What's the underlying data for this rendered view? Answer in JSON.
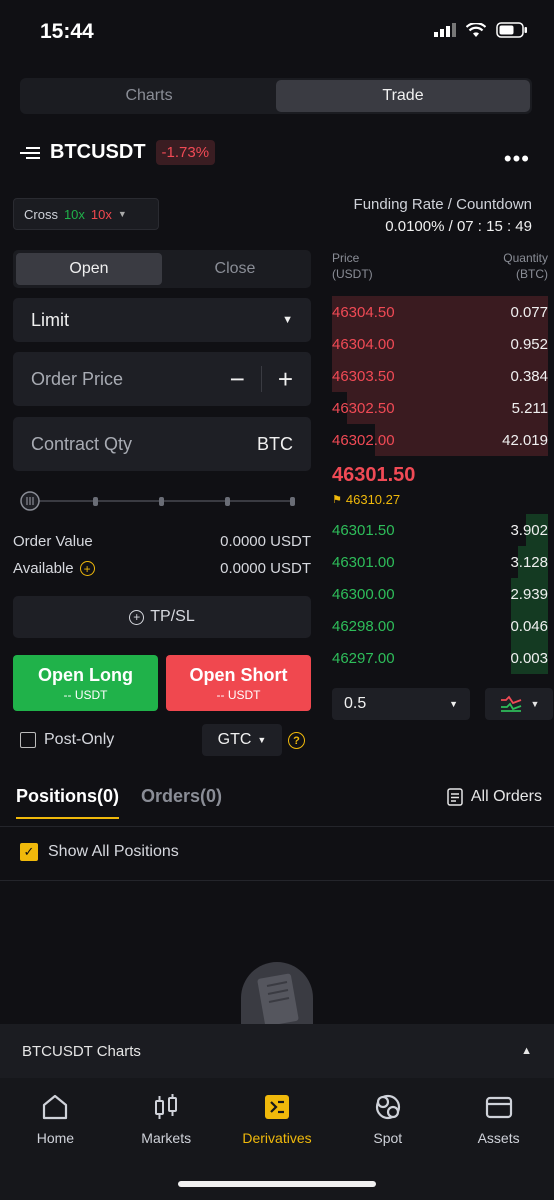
{
  "status": {
    "time": "15:44"
  },
  "view_tabs": [
    {
      "label": "Charts"
    },
    {
      "label": "Trade"
    }
  ],
  "symbol": {
    "name": "BTCUSDT",
    "change": "-1.73%"
  },
  "leverage": {
    "mode": "Cross",
    "long": "10x",
    "short": "10x"
  },
  "funding": {
    "label": "Funding Rate / Countdown",
    "value": "0.0100% / 07 : 15 : 49"
  },
  "order_tabs": [
    {
      "label": "Open"
    },
    {
      "label": "Close"
    }
  ],
  "order_type": "Limit",
  "order_price": {
    "placeholder": "Order Price"
  },
  "contract_qty": {
    "placeholder": "Contract Qty",
    "unit": "BTC"
  },
  "summary": {
    "order_value_label": "Order Value",
    "order_value": "0.0000 USDT",
    "available_label": "Available",
    "available": "0.0000 USDT"
  },
  "tpsl": "TP/SL",
  "open_long": {
    "label": "Open Long",
    "sub": "-- USDT"
  },
  "open_short": {
    "label": "Open Short",
    "sub": "-- USDT"
  },
  "post_only": "Post-Only",
  "time_in_force": "GTC",
  "orderbook": {
    "price_header": "Price",
    "price_unit": "(USDT)",
    "qty_header": "Quantity",
    "qty_unit": "(BTC)",
    "asks": [
      {
        "price": "46304.50",
        "qty": "0.077"
      },
      {
        "price": "46304.00",
        "qty": "0.952"
      },
      {
        "price": "46303.50",
        "qty": "0.384"
      },
      {
        "price": "46302.50",
        "qty": "5.211"
      },
      {
        "price": "46302.00",
        "qty": "42.019"
      }
    ],
    "last_price": "46301.50",
    "mark_price": "46310.27",
    "bids": [
      {
        "price": "46301.50",
        "qty": "3.902"
      },
      {
        "price": "46301.00",
        "qty": "3.128"
      },
      {
        "price": "46300.00",
        "qty": "2.939"
      },
      {
        "price": "46298.00",
        "qty": "0.046"
      },
      {
        "price": "46297.00",
        "qty": "0.003"
      }
    ],
    "depth": "0.5"
  },
  "positions_tabs": [
    {
      "label": "Positions(0)"
    },
    {
      "label": "Orders(0)"
    }
  ],
  "all_orders": "All Orders",
  "show_all_positions": "Show All Positions",
  "charts_bar": "BTCUSDT Charts",
  "nav": [
    {
      "label": "Home",
      "icon": "home-icon"
    },
    {
      "label": "Markets",
      "icon": "markets-icon"
    },
    {
      "label": "Derivatives",
      "icon": "derivatives-icon"
    },
    {
      "label": "Spot",
      "icon": "spot-icon"
    },
    {
      "label": "Assets",
      "icon": "wallet-icon"
    }
  ],
  "colors": {
    "accent": "#f0b90b",
    "buy": "#20b24a",
    "sell": "#f0484f"
  }
}
